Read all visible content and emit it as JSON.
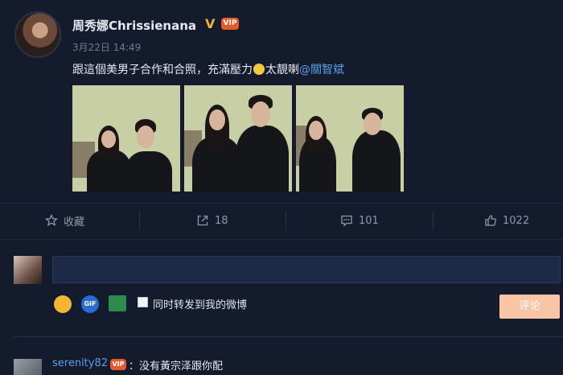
{
  "post": {
    "author": "周秀娜Chrissienana",
    "verified_badge": "V",
    "vip_badge": "VIP",
    "timestamp": "3月22日 14:49",
    "text_before_emoji": "跟這個美男子合作和合照，充滿壓力",
    "text_after_emoji": "太靚喇",
    "mention": "@關智斌",
    "emoji_name": "sweat-smile-emoji",
    "photos": [
      {
        "name": "photo-1"
      },
      {
        "name": "photo-2"
      },
      {
        "name": "photo-3"
      }
    ]
  },
  "actions": {
    "favorite": {
      "label": "收藏",
      "icon": "star-icon"
    },
    "repost": {
      "count": "18",
      "icon": "share-icon"
    },
    "comment": {
      "count": "101",
      "icon": "comment-icon"
    },
    "like": {
      "count": "1022",
      "icon": "thumbs-up-icon"
    },
    "active_color": "#5aa0e8"
  },
  "composer": {
    "value": "",
    "forward_label": "同时转发到我的微博",
    "submit_label": "评论",
    "gif_label": "GIF"
  },
  "first_comment": {
    "user": "serenity82",
    "vip_badge": "VIP",
    "text": "：没有黃宗泽跟你配"
  },
  "colors": {
    "background": "#141b2c",
    "link": "#5aa0e8",
    "submit": "#f8c6a6"
  }
}
